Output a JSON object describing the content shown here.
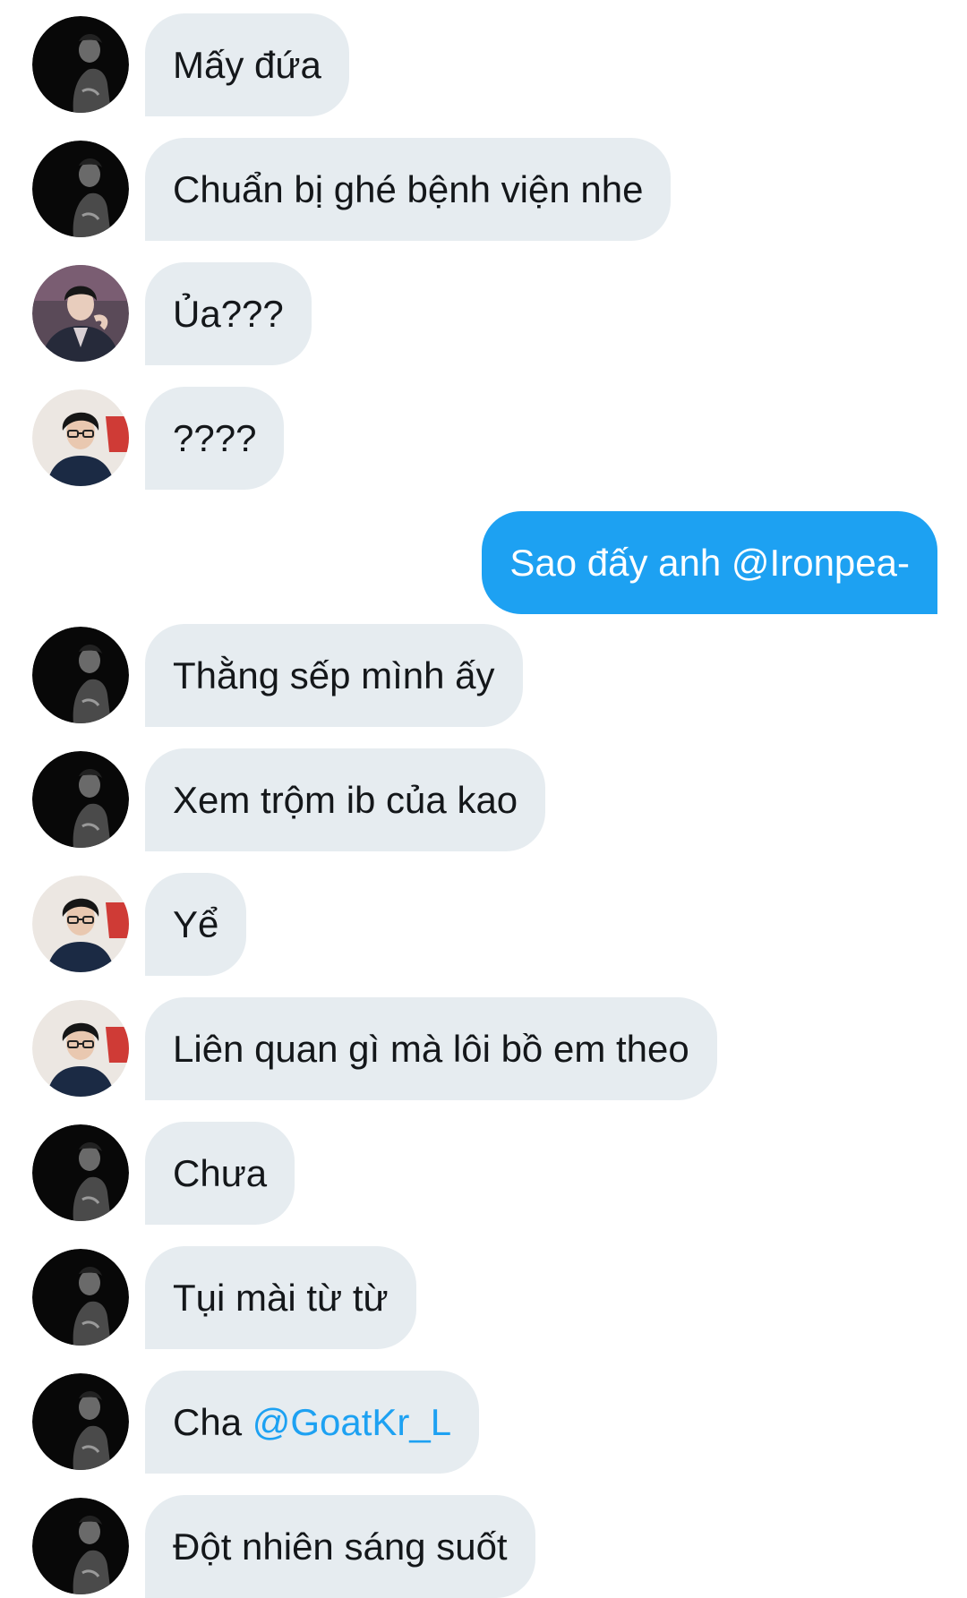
{
  "conversation": {
    "messages": [
      {
        "direction": "in",
        "avatar": "dark-profile-avatar",
        "text": "Mấy đứa"
      },
      {
        "direction": "in",
        "avatar": "dark-profile-avatar",
        "text": "Chuẩn bị ghé bệnh viện nhe"
      },
      {
        "direction": "in",
        "avatar": "suit-profile-avatar",
        "text": "Ủa???"
      },
      {
        "direction": "in",
        "avatar": "glasses-profile-avatar",
        "text": "????"
      },
      {
        "direction": "out",
        "text": "Sao đấy anh @Ironpea-"
      },
      {
        "direction": "in",
        "avatar": "dark-profile-avatar",
        "text": "Thằng sếp mình ấy"
      },
      {
        "direction": "in",
        "avatar": "dark-profile-avatar",
        "text": "Xem trộm ib của kao"
      },
      {
        "direction": "in",
        "avatar": "glasses-profile-avatar",
        "text": "Yể"
      },
      {
        "direction": "in",
        "avatar": "glasses-profile-avatar",
        "text": "Liên quan gì mà lôi bồ em theo"
      },
      {
        "direction": "in",
        "avatar": "dark-profile-avatar",
        "text": "Chưa"
      },
      {
        "direction": "in",
        "avatar": "dark-profile-avatar",
        "text": "Tụi mài từ từ"
      },
      {
        "direction": "in",
        "avatar": "dark-profile-avatar",
        "text_prefix": "Cha ",
        "mention": "@GoatKr_L"
      },
      {
        "direction": "in",
        "avatar": "dark-profile-avatar",
        "text": "Đột nhiên sáng suốt"
      }
    ]
  },
  "colors": {
    "incoming_bubble": "#e6ecf0",
    "outgoing_bubble": "#1da1f2",
    "mention": "#1da1f2",
    "text": "#14171a"
  }
}
